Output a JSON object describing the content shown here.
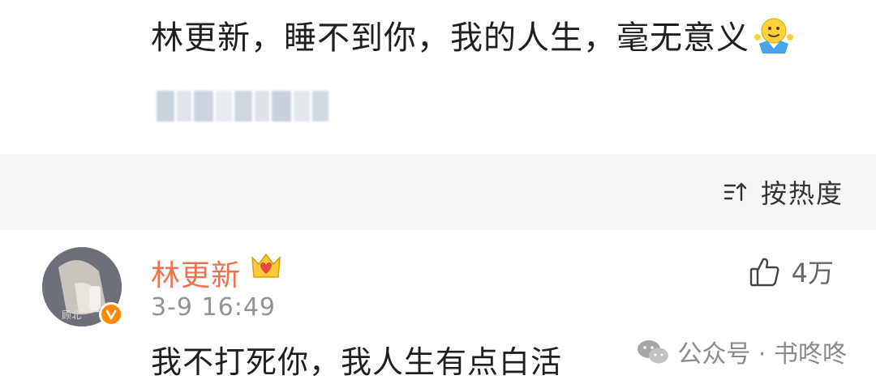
{
  "post": {
    "text": "林更新，睡不到你，我的人生，毫无意义",
    "emoji_icon": "shrug-emoji-icon",
    "blurred_user_icon": "mosaic-censored-username"
  },
  "sort": {
    "label": "按热度",
    "icon": "sort-lines-icon"
  },
  "comment": {
    "username": "林更新",
    "username_color": "#eb7350",
    "vip_icon": "crown-heart-badge-icon",
    "verified_icon": "orange-verified-v-icon",
    "time": "3-9 16:49",
    "text": "我不打死你，我人生有点白活",
    "likes": "4万",
    "like_icon": "thumbs-up-icon"
  },
  "watermark": {
    "icon": "wechat-icon",
    "text": "公众号 · 书咚咚"
  }
}
